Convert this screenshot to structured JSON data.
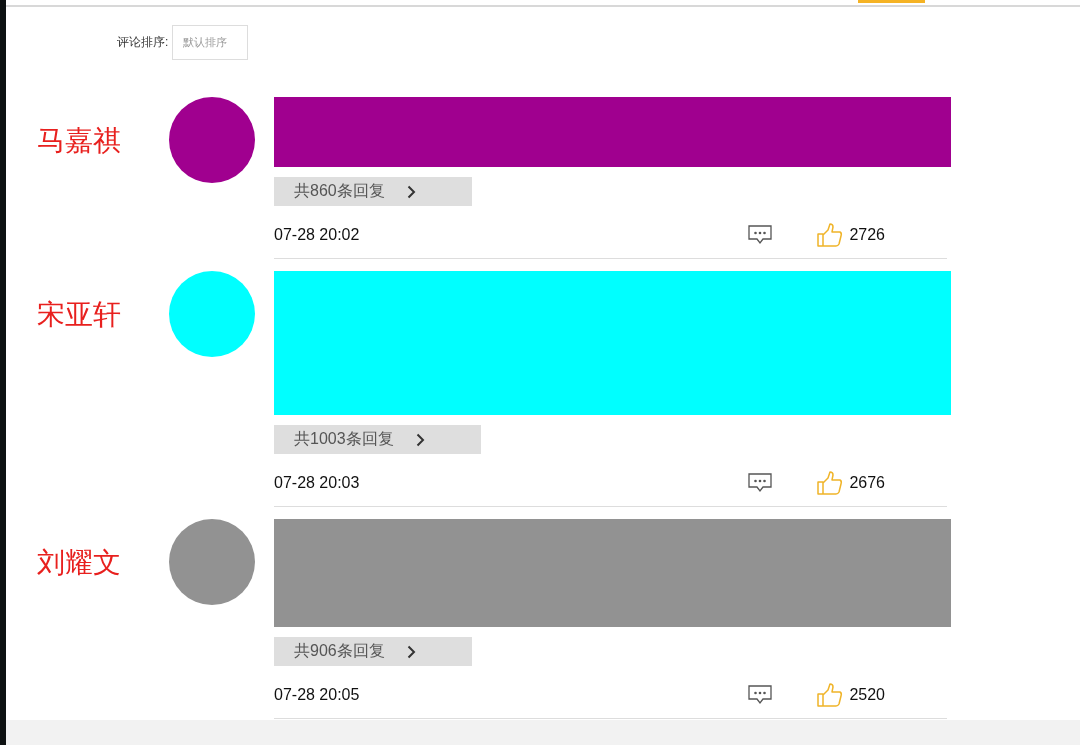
{
  "sort": {
    "label": "评论排序:",
    "value": "默认排序"
  },
  "comments": [
    {
      "name": "马嘉祺",
      "color": "#a0008f",
      "replies": "共860条回复",
      "time": "07-28 20:02",
      "likes": "2726"
    },
    {
      "name": "宋亚轩",
      "color": "#00ffff",
      "replies": "共1003条回复",
      "time": "07-28 20:03",
      "likes": "2676"
    },
    {
      "name": "刘耀文",
      "color": "#929292",
      "replies": "共906条回复",
      "time": "07-28 20:05",
      "likes": "2520"
    }
  ]
}
